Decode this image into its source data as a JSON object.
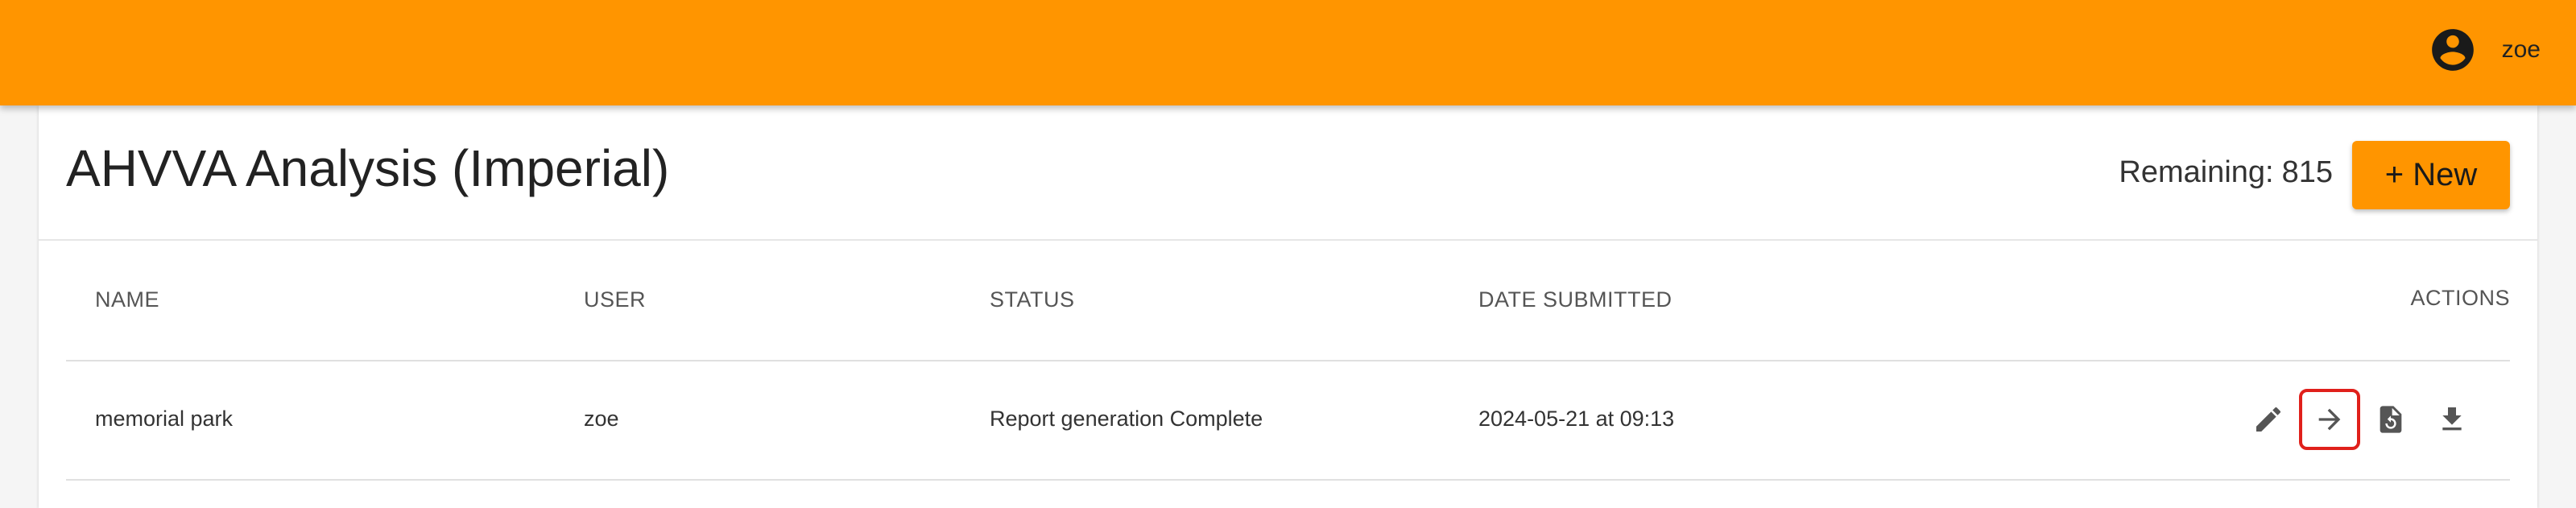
{
  "header": {
    "username": "zoe",
    "avatar_icon": "account-circle-icon",
    "bar_color": "#ff9500"
  },
  "page": {
    "title": "AHVVA Analysis (Imperial)",
    "remaining_label": "Remaining:",
    "remaining_value": "815",
    "new_button_label": "+ New"
  },
  "table": {
    "columns": {
      "name": "NAME",
      "user": "USER",
      "status": "STATUS",
      "date": "DATE SUBMITTED",
      "actions": "ACTIONS"
    },
    "rows": [
      {
        "name": "memorial park",
        "user": "zoe",
        "status": "Report generation Complete",
        "date": "2024-05-21 at 09:13",
        "actions": [
          "edit-icon",
          "arrow-right-icon",
          "file-restore-icon",
          "download-icon"
        ]
      }
    ]
  }
}
